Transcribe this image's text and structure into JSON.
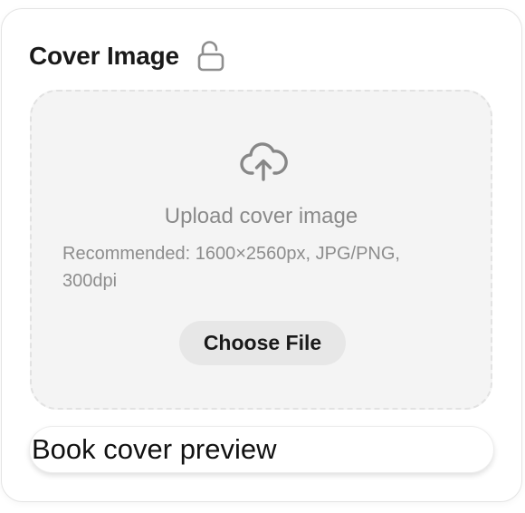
{
  "section": {
    "title": "Cover Image",
    "lock_icon": "unlocked-padlock-icon"
  },
  "upload": {
    "icon": "cloud-upload-icon",
    "title": "Upload cover image",
    "hint": "Recommended: 1600×2560px, JPG/PNG, 300dpi",
    "button_label": "Choose File"
  },
  "preview": {
    "alt_text": "Book cover preview"
  },
  "colors": {
    "dropzone_bg": "#f4f4f4",
    "dropzone_border": "#e2e2e2",
    "button_bg": "#e7e7e7",
    "icon": "#8a8a8a"
  }
}
